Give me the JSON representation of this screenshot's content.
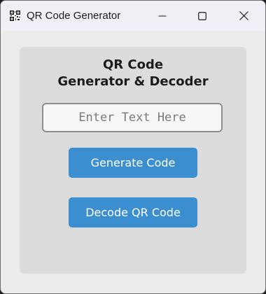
{
  "window": {
    "title": "QR Code Generator",
    "icon": "qr-code-icon"
  },
  "controls": {
    "minimize_icon": "minimize-icon",
    "maximize_icon": "maximize-icon",
    "close_icon": "close-icon"
  },
  "panel": {
    "heading_line1": "QR Code",
    "heading_line2": "Generator & Decoder"
  },
  "input": {
    "value": "",
    "placeholder": "Enter Text Here"
  },
  "buttons": {
    "generate_label": "Generate Code",
    "decode_label": "Decode QR Code"
  },
  "colors": {
    "accent": "#3b8ed0",
    "panel": "#dcdcdc",
    "background": "#ececec",
    "titlebar": "#f0f0f7"
  }
}
